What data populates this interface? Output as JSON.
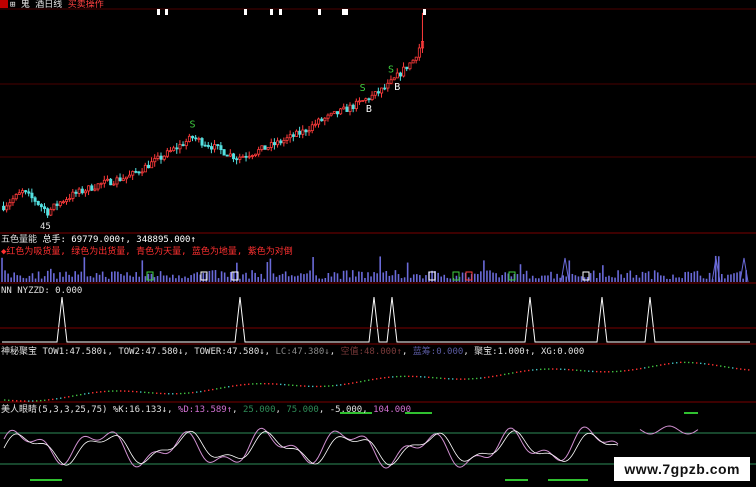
{
  "header": {
    "menu_items": [
      "⊞ 鬼 酒日线",
      "买卖操作"
    ]
  },
  "colors": {
    "background": "#000000",
    "up_candle": "#ff3b3b",
    "down_candle": "#54e0e0",
    "volume": "#6a6ad8",
    "signal_s": "#40d040",
    "signal_b": "#ffffff",
    "divider": "#7a0000",
    "zigzag": "#ffffff",
    "kdj_line": "#d090d0",
    "ref_line": "#2e8b57"
  },
  "price_panel": {
    "low_price_label": "45",
    "signals": [
      {
        "type": "S",
        "index": 60
      },
      {
        "type": "S",
        "index": 114
      },
      {
        "type": "B",
        "index": 116
      },
      {
        "type": "S",
        "index": 123
      },
      {
        "type": "B",
        "index": 125
      }
    ]
  },
  "volume_panel": {
    "title": "五色量能",
    "total_label": "总手: 69779.000↑, 348895.000↑",
    "legend": "◆红色为吸货量, 绿色为出货量, 青色为天量, 蓝色为地量, 紫色为对倒"
  },
  "zigzag_panel": {
    "label": "NN NYZZD: 0.000",
    "peaks": [
      62,
      75,
      115,
      121,
      163,
      186,
      200
    ]
  },
  "treasure_panel": {
    "title": "神秘聚宝",
    "values": [
      {
        "name": "TOW1",
        "value": "47.580↓"
      },
      {
        "name": "TOW2",
        "value": "47.580↓"
      },
      {
        "name": "TOWER",
        "value": "47.580↓"
      },
      {
        "name": "LC",
        "value": "47.380↓"
      },
      {
        "name": "空值",
        "value": "48.000↑"
      },
      {
        "name": "蓝筹",
        "value": "0.000"
      },
      {
        "name": "聚宝",
        "value": "1.000↑"
      },
      {
        "name": "XG",
        "value": "0.000"
      }
    ]
  },
  "kdj_panel": {
    "title": "美人眼睛",
    "params": "(5,3,3,25,75)",
    "values": [
      {
        "name": "%K",
        "value": "16.133↓"
      },
      {
        "name": "%D",
        "value": "13.589↑"
      },
      {
        "name": "",
        "value": "25.000"
      },
      {
        "name": "",
        "value": "75.000"
      },
      {
        "name": "",
        "value": "-5.000"
      },
      {
        "name": "",
        "value": "104.000"
      }
    ]
  },
  "chart_data": [
    {
      "type": "candlestick",
      "title": "",
      "x": "bar index 0–231",
      "price_path": [
        [
          0,
          46.8
        ],
        [
          6,
          47.8
        ],
        [
          10,
          47.2
        ],
        [
          14,
          46.4
        ],
        [
          18,
          47.1
        ],
        [
          22,
          47.6
        ],
        [
          30,
          48.3
        ],
        [
          40,
          48.9
        ],
        [
          50,
          50.2
        ],
        [
          60,
          51.6
        ],
        [
          64,
          51.2
        ],
        [
          70,
          50.6
        ],
        [
          74,
          50.2
        ],
        [
          80,
          50.6
        ],
        [
          88,
          51.3
        ],
        [
          95,
          52.0
        ],
        [
          100,
          52.7
        ],
        [
          106,
          53.3
        ],
        [
          112,
          53.9
        ],
        [
          118,
          54.6
        ],
        [
          122,
          55.2
        ],
        [
          126,
          56.1
        ],
        [
          130,
          57.0
        ],
        [
          133,
          58.3
        ]
      ],
      "ylim": [
        45.0,
        60.5
      ]
    },
    {
      "type": "bar",
      "title": "五色量能",
      "note": "volume histogram under the price panel",
      "ylim": [
        0,
        100
      ]
    },
    {
      "type": "line",
      "title": "NN NYZZD",
      "peak_indices": [
        62,
        75,
        115,
        121,
        163,
        186,
        200
      ],
      "ylim": [
        0,
        1
      ]
    },
    {
      "type": "line",
      "title": "美人眼睛 %K",
      "ref_lines": [
        25,
        75,
        -5,
        104
      ],
      "ylim": [
        -10,
        110
      ]
    }
  ]
}
